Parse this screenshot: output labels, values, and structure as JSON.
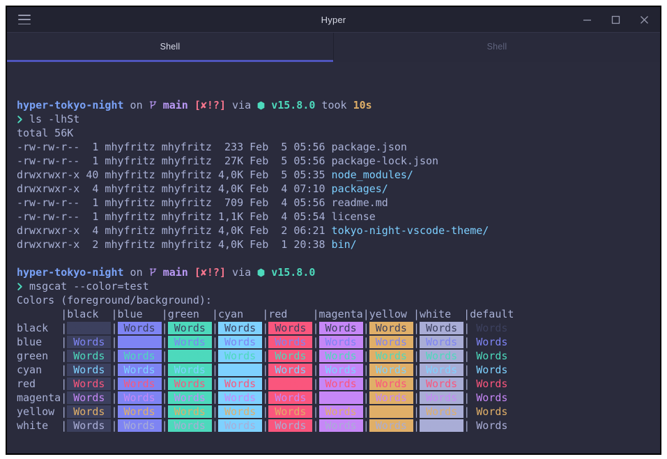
{
  "window": {
    "title": "Hyper"
  },
  "tabs": [
    {
      "label": "Shell",
      "active": true
    },
    {
      "label": "Shell",
      "active": false
    }
  ],
  "palette": {
    "page_bg": "#ffffff",
    "window_border": "#000000",
    "titlebar_bg": "#222331",
    "tabbar_bg": "#292a3b",
    "title_fg": "#d6d8e4",
    "controls_fg": "#9699ad",
    "tab_active_fg": "#d8dae8",
    "tab_inactive_fg": "#60647e",
    "tab_underline": "#4f55bd",
    "background": "#2a2b3c",
    "foreground": "#a9b1d6",
    "black": "#3c405e",
    "red": "#fa567d",
    "green": "#4dd9bc",
    "yellow": "#e0af68",
    "blue": "#7e84f3",
    "magenta": "#c687f7",
    "cyan": "#7ed1ff",
    "white": "#a9add6",
    "dir_blue": "#7aa2f7",
    "ls_dir": "#7dcfff",
    "git_purple": "#bb9af7",
    "status_red": "#f7768e"
  },
  "terminal": {
    "lines": [
      [],
      [],
      [
        {
          "t": "hyper-tokyo-night",
          "c": "dir_blue",
          "b": 1
        },
        {
          "t": " on "
        },
        {
          "i": "git-branch-icon",
          "c": "git_purple"
        },
        {
          "t": " "
        },
        {
          "t": "main",
          "c": "git_purple",
          "b": 1
        },
        {
          "t": " "
        },
        {
          "t": "[✘!?]",
          "c": "status_red",
          "b": 1
        },
        {
          "t": " via "
        },
        {
          "i": "node-icon",
          "c": "green"
        },
        {
          "t": " "
        },
        {
          "t": "v15.8.0",
          "c": "green",
          "b": 1
        },
        {
          "t": " took "
        },
        {
          "t": "10s",
          "c": "yellow",
          "b": 1
        }
      ],
      [
        {
          "i": "chevron-icon",
          "c": "green"
        },
        {
          "t": " ls -lhSt"
        }
      ],
      [
        {
          "t": "total 56K"
        }
      ],
      [
        {
          "t": "-rw-rw-r--  1 mhyfritz mhyfritz  233 Feb  5 05:56 "
        },
        {
          "t": "package.json"
        }
      ],
      [
        {
          "t": "-rw-rw-r--  1 mhyfritz mhyfritz  27K Feb  5 05:56 "
        },
        {
          "t": "package-lock.json"
        }
      ],
      [
        {
          "t": "drwxrwxr-x 40 mhyfritz mhyfritz 4,0K Feb  5 05:35 "
        },
        {
          "t": "node_modules/",
          "c": "ls_dir"
        }
      ],
      [
        {
          "t": "drwxrwxr-x  4 mhyfritz mhyfritz 4,0K Feb  4 07:10 "
        },
        {
          "t": "packages/",
          "c": "ls_dir"
        }
      ],
      [
        {
          "t": "-rw-rw-r--  1 mhyfritz mhyfritz  709 Feb  4 05:56 "
        },
        {
          "t": "readme.md"
        }
      ],
      [
        {
          "t": "-rw-rw-r--  1 mhyfritz mhyfritz 1,1K Feb  4 05:54 "
        },
        {
          "t": "license"
        }
      ],
      [
        {
          "t": "drwxrwxr-x  4 mhyfritz mhyfritz 4,0K Feb  2 06:21 "
        },
        {
          "t": "tokyo-night-vscode-theme/",
          "c": "ls_dir"
        }
      ],
      [
        {
          "t": "drwxrwxr-x  2 mhyfritz mhyfritz 4,0K Feb  1 20:38 "
        },
        {
          "t": "bin/",
          "c": "ls_dir"
        }
      ],
      [],
      [
        {
          "t": "hyper-tokyo-night",
          "c": "dir_blue",
          "b": 1
        },
        {
          "t": " on "
        },
        {
          "i": "git-branch-icon",
          "c": "git_purple"
        },
        {
          "t": " "
        },
        {
          "t": "main",
          "c": "git_purple",
          "b": 1
        },
        {
          "t": " "
        },
        {
          "t": "[✘!?]",
          "c": "status_red",
          "b": 1
        },
        {
          "t": " via "
        },
        {
          "i": "node-icon",
          "c": "green"
        },
        {
          "t": " "
        },
        {
          "t": "v15.8.0",
          "c": "green",
          "b": 1
        }
      ],
      [
        {
          "i": "chevron-icon",
          "c": "green"
        },
        {
          "t": " msgcat --color=test"
        }
      ],
      [
        {
          "t": "Colors (foreground/background):"
        }
      ]
    ],
    "color_table": {
      "rows": [
        "black",
        "blue",
        "green",
        "cyan",
        "red",
        "magenta",
        "yellow",
        "white"
      ],
      "columns": [
        "black",
        "blue",
        "green",
        "cyan",
        "red",
        "magenta",
        "yellow",
        "white",
        "default"
      ],
      "cell_text": "Words",
      "label_width": 7
    }
  }
}
